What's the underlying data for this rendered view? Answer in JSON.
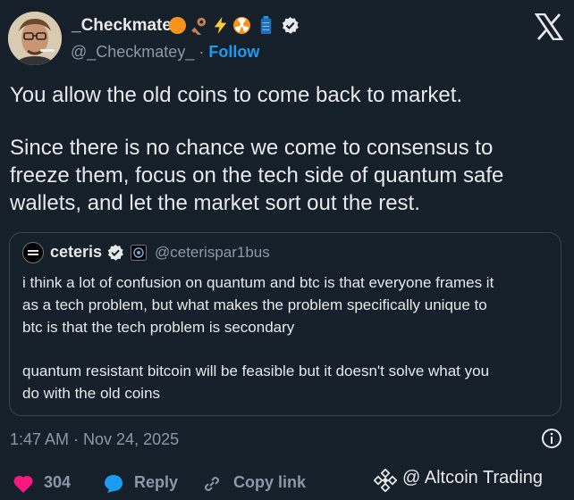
{
  "author": {
    "display_name": "_Checkmate",
    "handle": "@_Checkmatey_",
    "separator": "·",
    "follow_label": "Follow"
  },
  "tweet": {
    "paragraph1": "You allow the old coins to come back to market.",
    "paragraph2_line1": "Since there is no chance we come to consensus to",
    "paragraph2_line2": "freeze them, focus on the tech side of quantum safe",
    "paragraph2_line3": "wallets, and let the market sort out the rest."
  },
  "quote": {
    "display_name": "ceteris",
    "handle": "@ceterispar1bus",
    "line1": "i think a lot of confusion on quantum and btc is that everyone frames it",
    "line2": "as a tech problem, but what makes the problem specifically unique to",
    "line3": "btc is that the tech problem is secondary",
    "line4": "quantum resistant bitcoin will be feasible but it doesn't solve what you",
    "line5": "do with the old coins"
  },
  "timestamp": "1:47 AM · Nov 24, 2025",
  "actions": {
    "like_count": "304",
    "reply_label": "Reply",
    "copy_link_label": "Copy link"
  },
  "watermark": "@ Altcoin Trading",
  "icons": {
    "verified": "verified-badge-icon",
    "close": "x-logo-icon",
    "info": "info-icon",
    "like": "heart-icon",
    "reply": "speech-bubble-icon",
    "copy": "link-icon",
    "brand": "binance-diamond-icon"
  },
  "colors": {
    "background": "#15202b",
    "accent": "#1d9bf0",
    "like": "#f91880",
    "secondary_text": "#8b98a5"
  }
}
